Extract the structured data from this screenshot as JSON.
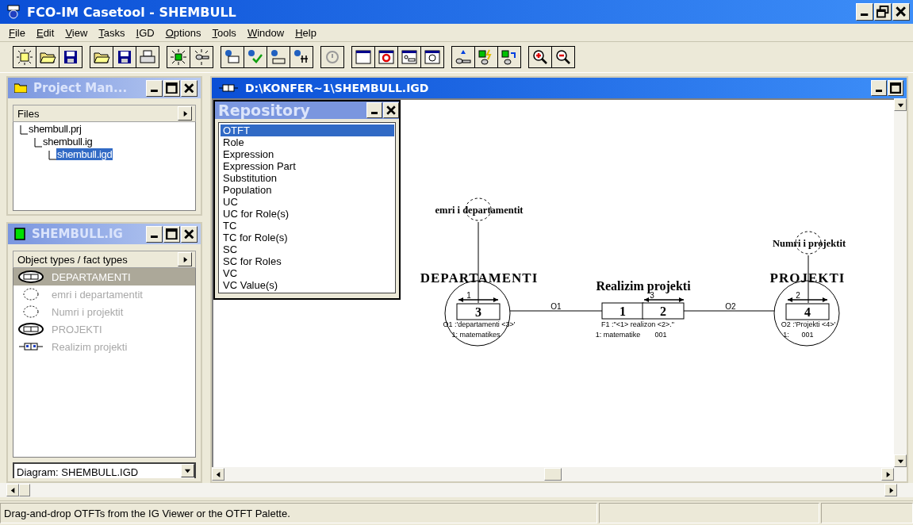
{
  "window": {
    "title": "FCO-IM Casetool - SHEMBULL"
  },
  "menu": [
    {
      "label": "File"
    },
    {
      "label": "Edit"
    },
    {
      "label": "View"
    },
    {
      "label": "Tasks"
    },
    {
      "label": "IGD"
    },
    {
      "label": "Options"
    },
    {
      "label": "Tools"
    },
    {
      "label": "Window"
    },
    {
      "label": "Help"
    }
  ],
  "project_manager": {
    "title": "Project Man...",
    "header": "Files",
    "tree": [
      {
        "label": "shembull.prj",
        "selected": false,
        "children": [
          {
            "label": "shembull.ig",
            "selected": false,
            "children": [
              {
                "label": "shembull.igd",
                "selected": true
              }
            ]
          }
        ]
      }
    ]
  },
  "ig_viewer": {
    "title": "SHEMBULL.IG",
    "header": "Object types / fact types",
    "items": [
      {
        "label": "DEPARTAMENTI",
        "kind": "entity",
        "selected": true
      },
      {
        "label": "emri i departamentit",
        "kind": "label",
        "selected": false
      },
      {
        "label": "Numri i projektit",
        "kind": "label",
        "selected": false
      },
      {
        "label": "PROJEKTI",
        "kind": "entity",
        "selected": false
      },
      {
        "label": "Realizim projekti",
        "kind": "fact",
        "selected": false
      }
    ],
    "diagram_select": "Diagram: SHEMBULL.IGD"
  },
  "document": {
    "title": "D:\\KONFER~1\\SHEMBULL.IGD"
  },
  "repository": {
    "title": "Repository",
    "items": [
      {
        "label": "OTFT",
        "selected": true
      },
      {
        "label": "Role",
        "selected": false
      },
      {
        "label": "Expression",
        "selected": false
      },
      {
        "label": "Expression Part",
        "selected": false
      },
      {
        "label": "Substitution",
        "selected": false
      },
      {
        "label": "Population",
        "selected": false
      },
      {
        "label": "UC",
        "selected": false
      },
      {
        "label": "UC for Role(s)",
        "selected": false
      },
      {
        "label": "TC",
        "selected": false
      },
      {
        "label": "TC for Role(s)",
        "selected": false
      },
      {
        "label": "SC",
        "selected": false
      },
      {
        "label": "SC for Roles",
        "selected": false
      },
      {
        "label": "VC",
        "selected": false
      },
      {
        "label": "VC Value(s)",
        "selected": false
      }
    ]
  },
  "diagram": {
    "label_types": [
      {
        "name": "emri i departamentit"
      },
      {
        "name": "Numri i projektit"
      }
    ],
    "object_types": [
      {
        "name": "DEPARTAMENTI",
        "role_number": "3",
        "role_label": "1",
        "expression": "O1 :'departamenti <3>'",
        "population": [
          "1: matematikes"
        ]
      },
      {
        "name": "PROJEKTI",
        "role_number": "4",
        "role_label": "2",
        "expression": "O2 :'Projekti <4>'",
        "population": [
          "1:",
          "001"
        ]
      }
    ],
    "fact_type": {
      "name": "Realizim projekti",
      "roles": [
        {
          "number": "1"
        },
        {
          "number": "2",
          "label": "3"
        }
      ],
      "expression": "F1 :\"<1> realizon <2>.\"",
      "population": [
        "1: matematike",
        "001"
      ]
    },
    "connectors": [
      "O1",
      "O2"
    ]
  },
  "status_bar": {
    "message": "Drag-and-drop OTFTs from the IG Viewer or the OTFT Palette."
  }
}
